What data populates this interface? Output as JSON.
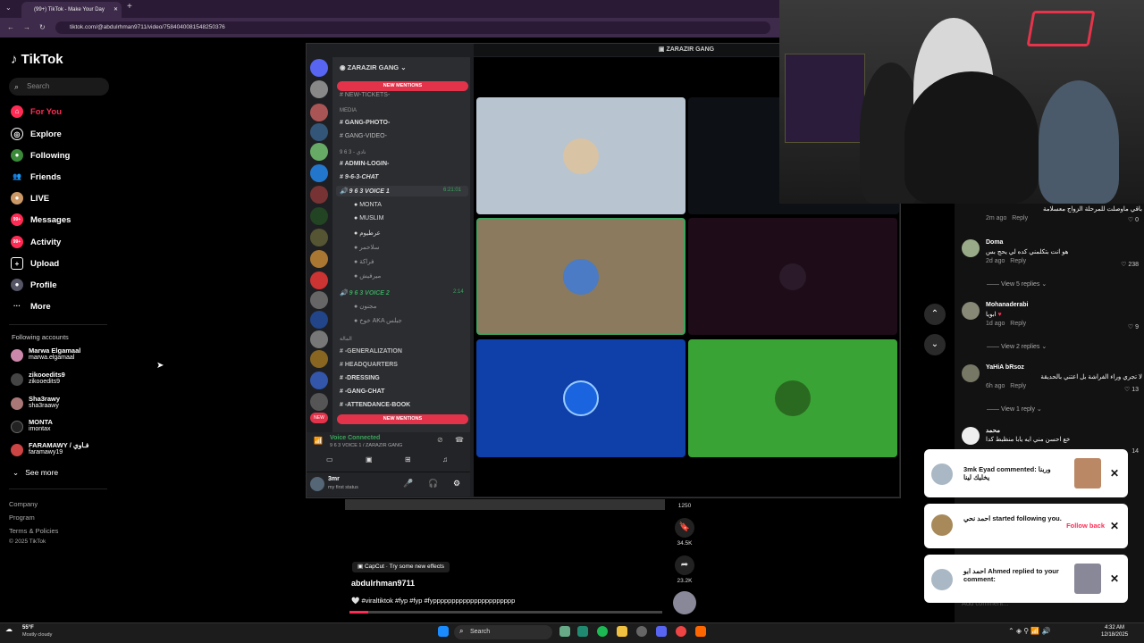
{
  "browser": {
    "tab_title": "(99+) TikTok - Make Your Day",
    "url": "tiktok.com/@abdulrhman9711/video/7584040081548250376"
  },
  "tiktok": {
    "logo": "TikTok",
    "search_placeholder": "Search",
    "nav": [
      {
        "label": "For You",
        "icon": "home-icon",
        "color": "#fe2c55"
      },
      {
        "label": "Explore",
        "icon": "compass-icon",
        "color": "#ffffff"
      },
      {
        "label": "Following",
        "icon": "following-icon",
        "color": "#ffffff"
      },
      {
        "label": "Friends",
        "icon": "friends-icon",
        "color": "#ffffff"
      },
      {
        "label": "LIVE",
        "icon": "live-icon",
        "color": "#ffffff"
      },
      {
        "label": "Messages",
        "icon": "messages-icon",
        "badge": "99+",
        "color": "#ffffff"
      },
      {
        "label": "Activity",
        "icon": "activity-icon",
        "badge": "99+",
        "color": "#ffffff"
      },
      {
        "label": "Upload",
        "icon": "upload-icon",
        "color": "#ffffff"
      },
      {
        "label": "Profile",
        "icon": "profile-icon",
        "color": "#ffffff"
      },
      {
        "label": "More",
        "icon": "more-icon",
        "color": "#ffffff"
      }
    ],
    "following_accounts_title": "Following accounts",
    "accounts": [
      {
        "name": "Marwa Elgamaal",
        "handle": "marwa.elgamaal"
      },
      {
        "name": "zikooedits9",
        "handle": "zikooedits9"
      },
      {
        "name": "Sha3rawy",
        "handle": "sha3raawy"
      },
      {
        "name": "MONTA",
        "handle": "imontax"
      },
      {
        "name": "FARAMAWY / فـاوي",
        "handle": "faramawy19"
      }
    ],
    "see_more": "See more",
    "footer": [
      "Company",
      "Program",
      "Terms & Policies",
      "© 2025 TikTok"
    ]
  },
  "discord": {
    "server_name": "ZARAZIR GANG",
    "top_title": "ZARAZIR GANG",
    "new_mentions": "NEW MENTIONS",
    "channels": [
      "NEW-TICKETS-",
      "MEDIA",
      "GANG-PHOTO-",
      "GANG-VIDEO-",
      "9 6 3 - نادي",
      "ADMIN-LOGIN-",
      "9-6-3-CHAT",
      "9 6 3 VOICE 1",
      "MONTA",
      "MUSLIM",
      "عرطيوم",
      "سلاحمر",
      "فراكة",
      "ميرفيش",
      "9 6 3 VOICE 2",
      "مجنون",
      "خوخ AKA جبلس",
      "المالة",
      "-GENERALIZATION",
      "HEADQUARTERS",
      "-DRESSING",
      "-GANG-CHAT",
      "-ATTENDANCE-BOOK"
    ],
    "voice1_timer": "6:21:01",
    "voice2_timer": "2:14",
    "voice_connected": "Voice Connected",
    "voice_sub": "9 6 3 VOICE 1 / ZARAZIR GANG",
    "user_name": "3mr",
    "user_status": "my first status"
  },
  "video": {
    "effect_label": "CapCut · Try some new effects",
    "author": "abdulrhman9711",
    "caption": "#viraltiktok #fyp #fyp #fypppppppppppppppppppppp",
    "like_count": "1250",
    "save_count": "34.5K",
    "share_count": "23.2K",
    "progress": 0.06
  },
  "comments": [
    {
      "name": "",
      "text": "باقي ماوصلت للمرحلة الزواج معسلامة",
      "time": "2m ago",
      "reply": "Reply",
      "likes": "0"
    },
    {
      "name": "Doma",
      "text": "هو انت بتكلمني كده لي يحج بس",
      "time": "2d ago",
      "reply": "Reply",
      "likes": "238",
      "replies": "View 5 replies"
    },
    {
      "name": "Mohanaderabi",
      "text": "ابويا",
      "time": "1d ago",
      "reply": "Reply",
      "likes": "9",
      "replies": "View 2 replies"
    },
    {
      "name": "YaHiA bRsoz",
      "text": "لا تجري وراء الفراشة بل اعتني بالحديقة",
      "time": "6h ago",
      "reply": "Reply",
      "likes": "13",
      "replies": "View 1 reply"
    },
    {
      "name": "محمد",
      "text": "خع احسن مني ايه يابا منظبط كدا",
      "time": "",
      "reply": "",
      "likes": "14"
    }
  ],
  "notifications": [
    {
      "text": "3mk Eyad commented: وربنا يخليك لينا",
      "action": ""
    },
    {
      "text": "احمد نحي started following you.",
      "action": "Follow back"
    },
    {
      "text": "احمد ابو Ahmed replied to your comment:",
      "action": ""
    }
  ],
  "comment_input_placeholder": "Add comment...",
  "taskbar": {
    "weather_temp": "55°F",
    "weather_desc": "Mostly cloudy",
    "search": "Search",
    "time": "4:32 AM",
    "date": "12/18/2025"
  }
}
